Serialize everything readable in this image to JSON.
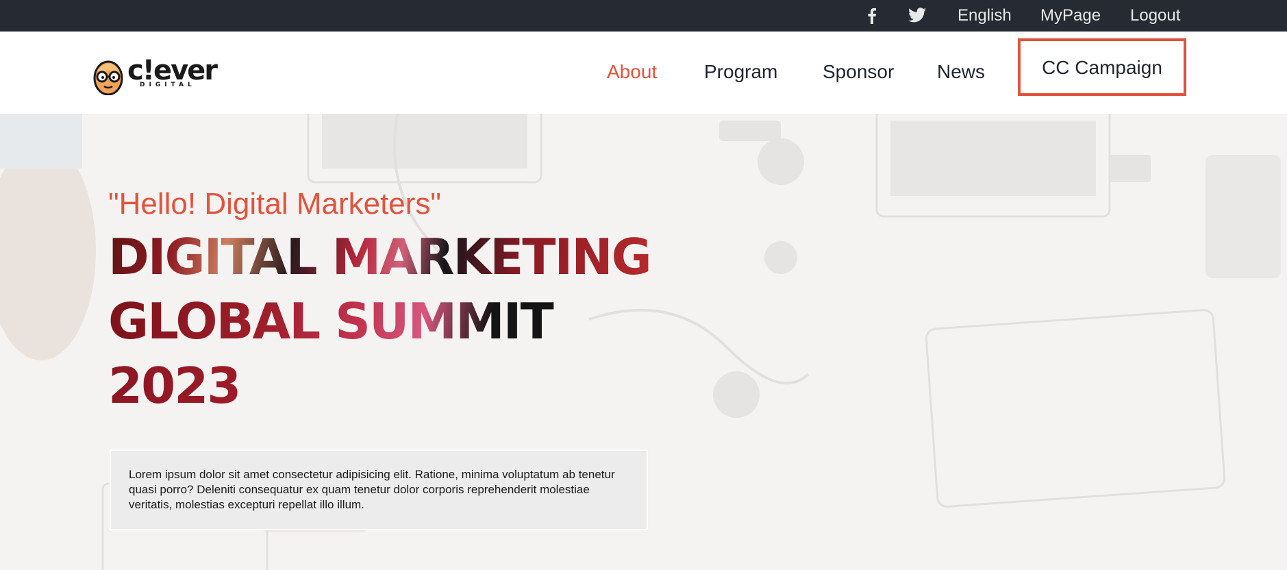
{
  "topbar": {
    "facebook_icon": "facebook-icon",
    "twitter_icon": "twitter-icon",
    "language": "English",
    "mypage": "MyPage",
    "logout": "Logout"
  },
  "brand": {
    "logo_word": "c!ever",
    "logo_sub": "DIGITAL"
  },
  "nav": {
    "items": [
      {
        "label": "About"
      },
      {
        "label": "Program"
      },
      {
        "label": "Sponsor"
      },
      {
        "label": "News"
      }
    ],
    "cta": "CC Campaign"
  },
  "hero": {
    "greeting": "\"Hello! Digital Marketers\"",
    "title_lines": [
      "DIGITAL MARKETING",
      "GLOBAL SUMMIT",
      "2023"
    ],
    "description": "Lorem ipsum dolor sit amet consectetur adipisicing elit. Ratione, minima voluptatum ab tenetur quasi porro? Deleniti consequatur ex quam tenetur dolor corporis reprehenderit molestiae veritatis, molestias excepturi repellat illo illum."
  },
  "colors": {
    "accent": "#e1533c",
    "topbar_bg": "#262a33",
    "nav_text": "#1e2430"
  }
}
